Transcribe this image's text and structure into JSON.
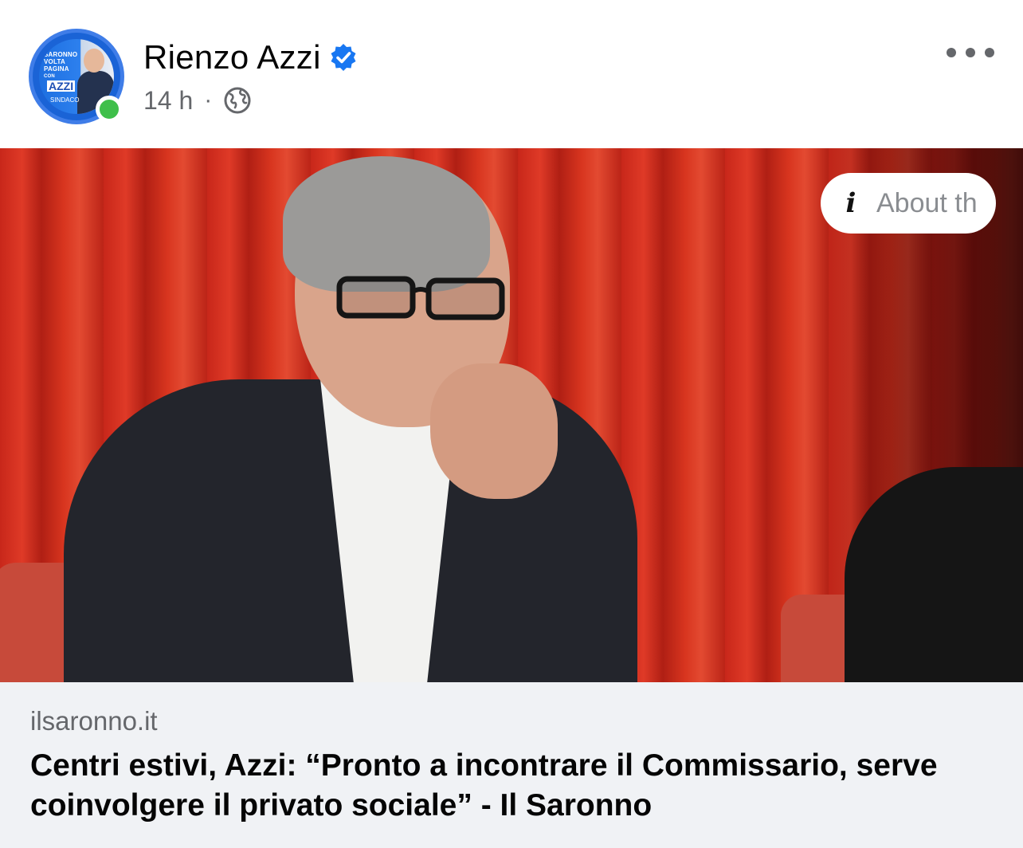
{
  "post": {
    "author_name": "Rienzo Azzi",
    "timestamp": "14 h",
    "separator": "·",
    "verified_icon": "verified-badge-icon",
    "audience_icon": "globe-icon",
    "more_icon": "more-options-icon"
  },
  "avatar": {
    "line1": "SARONNO",
    "line2": "VOLTA",
    "line3": "PAGINA",
    "line4": "CON",
    "badge": "AZZI",
    "subtitle": "SINDACO"
  },
  "image_overlay": {
    "about_label": "About th"
  },
  "link_preview": {
    "domain": "ilsaronno.it",
    "title": "Centri estivi, Azzi: “Pronto a incontrare il Commissario, serve coinvolgere il privato sociale” - Il Saronno"
  },
  "colors": {
    "verified_blue": "#1877f2",
    "online_green": "#3fbf4a",
    "card_bg": "#f0f2f5"
  }
}
